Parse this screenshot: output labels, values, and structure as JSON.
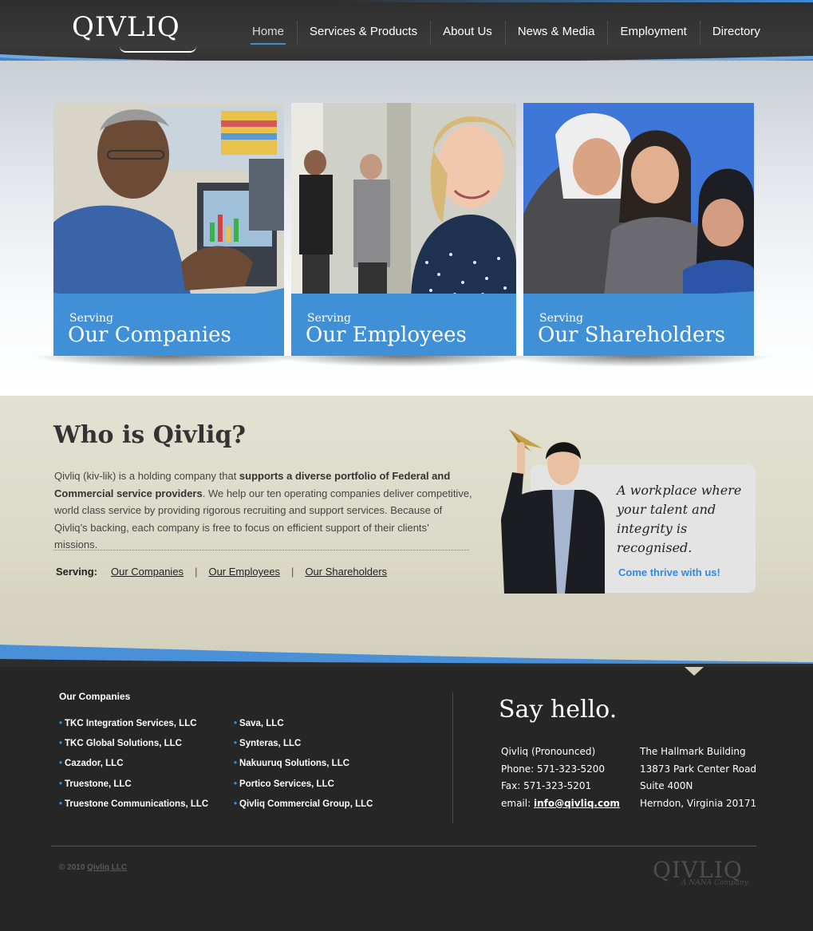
{
  "brand": {
    "logo_text": "QIVLIQ",
    "accent": "#3e8bd6",
    "panel_blue": "#4090d8"
  },
  "nav": {
    "items": [
      {
        "label": "Home",
        "active": true
      },
      {
        "label": "Services & Products"
      },
      {
        "label": "About Us"
      },
      {
        "label": "News & Media"
      },
      {
        "label": "Employment"
      },
      {
        "label": "Directory"
      }
    ]
  },
  "hero": {
    "cards": [
      {
        "kicker": "Serving",
        "title": "Our Companies",
        "photo": "man-at-computer-photo"
      },
      {
        "kicker": "Serving",
        "title": "Our Employees",
        "photo": "smiling-woman-photo"
      },
      {
        "kicker": "Serving",
        "title": "Our Shareholders",
        "photo": "group-of-kids-photo"
      }
    ]
  },
  "about": {
    "heading": "Who is Qivliq?",
    "text_1": "Qivliq (kiv-lik) is a holding company that ",
    "text_bold": "supports a diverse portfolio of Federal and Commercial service providers",
    "text_2": ". We help our ten operating companies deliver competitive, world class service by providing rigorous recruiting and support services. Because of Qivliq’s backing, each company is free to focus on efficient support of their clients’ missions.",
    "serving_label": "Serving:",
    "serving_links": [
      "Our Companies",
      "Our Employees",
      "Our Shareholders"
    ],
    "separator": "|"
  },
  "promo": {
    "quote_1": "A workplace where",
    "quote_2": "your talent and",
    "quote_3": "integrity is recognised.",
    "cta": "Come thrive with us!"
  },
  "footer": {
    "companies_title": "Our Companies",
    "companies_left": [
      "TKC Integration Services, LLC",
      "TKC Global Solutions, LLC",
      "Cazador, LLC",
      "Truestone, LLC",
      "Truestone Communications, LLC"
    ],
    "companies_right": [
      "Sava, LLC",
      "Synteras, LLC",
      "Nakuuruq Solutions, LLC",
      "Portico Services, LLC",
      "Qivliq Commercial Group, LLC"
    ],
    "bullet": "•",
    "say_hello": "Say hello.",
    "contact_left": {
      "pronounced": "Qivliq (Pronounced)",
      "phone": "Phone: 571-323-5200",
      "fax": "Fax: 571-323-5201",
      "email_label": "email: ",
      "email": "info@qivliq.com"
    },
    "contact_right": {
      "line1": "The Hallmark Building",
      "line2": "13873 Park Center Road",
      "line3": "Suite 400N",
      "line4": "Herndon, Virginia 20171"
    },
    "copyright_prefix": "© 2010 ",
    "copyright_link": "Qivliq LLC",
    "footer_logo": "QIVLIQ",
    "footer_logo_sub": "A NANA Company"
  }
}
